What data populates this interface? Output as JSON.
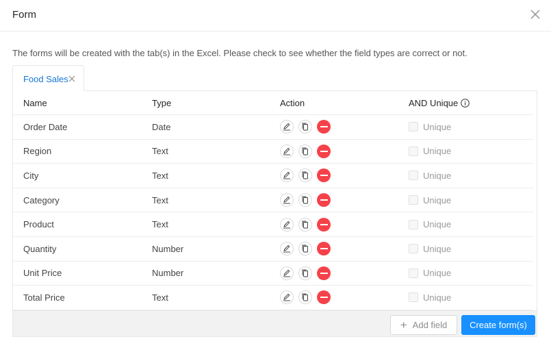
{
  "dialog": {
    "title": "Form"
  },
  "description": "The forms will be created with the tab(s) in the Excel. Please check to see whether the field types are correct or not.",
  "tab": {
    "label": "Food Sales"
  },
  "table": {
    "headers": {
      "name": "Name",
      "type": "Type",
      "action": "Action",
      "unique": "AND Unique"
    },
    "rows": [
      {
        "name": "Order Date",
        "type": "Date",
        "unique_label": "Unique"
      },
      {
        "name": "Region",
        "type": "Text",
        "unique_label": "Unique"
      },
      {
        "name": "City",
        "type": "Text",
        "unique_label": "Unique"
      },
      {
        "name": "Category",
        "type": "Text",
        "unique_label": "Unique"
      },
      {
        "name": "Product",
        "type": "Text",
        "unique_label": "Unique"
      },
      {
        "name": "Quantity",
        "type": "Number",
        "unique_label": "Unique"
      },
      {
        "name": "Unit Price",
        "type": "Number",
        "unique_label": "Unique"
      },
      {
        "name": "Total Price",
        "type": "Text",
        "unique_label": "Unique"
      }
    ]
  },
  "footer": {
    "add_field": "Add field",
    "create": "Create form(s)"
  },
  "colors": {
    "accent": "#1890ff",
    "delete": "#f5424a",
    "tab_text": "#1677d2"
  },
  "icons": {
    "close": "close-icon",
    "tab_close": "close-icon",
    "info": "info-icon",
    "edit": "pencil-icon",
    "copy": "copy-icon",
    "delete": "minus-circle-icon",
    "add": "plus-icon"
  }
}
